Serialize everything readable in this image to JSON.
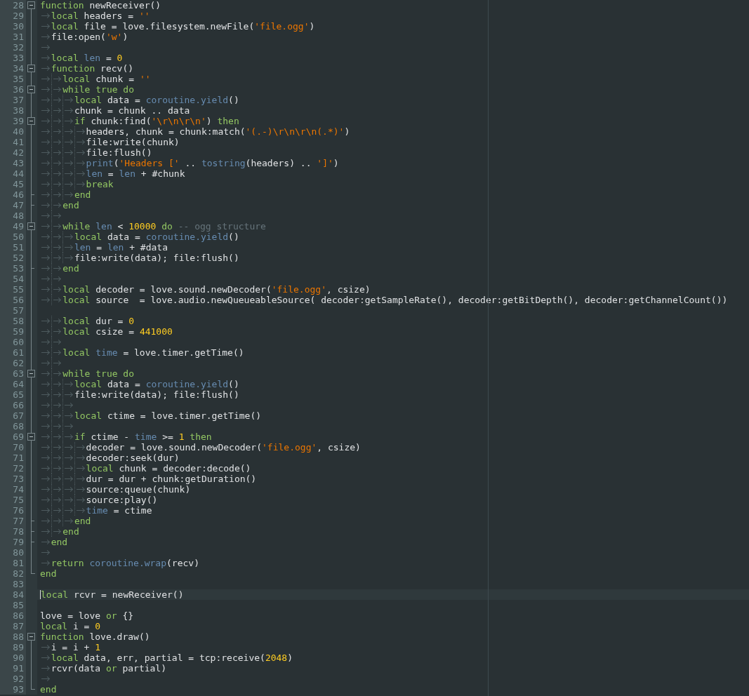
{
  "editor": {
    "lines": [
      {
        "number": "28",
        "foldable": true,
        "block_end": false,
        "current": false,
        "tokens": [
          {
            "kind": "keyword",
            "text": "function"
          },
          {
            "kind": "plain",
            "text": " newReceiver()"
          }
        ]
      },
      {
        "number": "29",
        "foldable": false,
        "block_end": false,
        "current": false,
        "tokens": [
          {
            "kind": "tab"
          },
          {
            "kind": "keyword",
            "text": "local"
          },
          {
            "kind": "plain",
            "text": " headers = "
          },
          {
            "kind": "string",
            "text": "''"
          }
        ]
      },
      {
        "number": "30",
        "foldable": false,
        "block_end": false,
        "current": false,
        "tokens": [
          {
            "kind": "tab"
          },
          {
            "kind": "keyword",
            "text": "local"
          },
          {
            "kind": "plain",
            "text": " file = love.filesystem.newFile("
          },
          {
            "kind": "string",
            "text": "'file.ogg'"
          },
          {
            "kind": "plain",
            "text": ")"
          }
        ]
      },
      {
        "number": "31",
        "foldable": false,
        "block_end": false,
        "current": false,
        "tokens": [
          {
            "kind": "tab"
          },
          {
            "kind": "plain",
            "text": "file:open("
          },
          {
            "kind": "string",
            "text": "'w'"
          },
          {
            "kind": "plain",
            "text": ")"
          }
        ]
      },
      {
        "number": "32",
        "foldable": false,
        "block_end": false,
        "current": false,
        "tokens": [
          {
            "kind": "tab"
          }
        ]
      },
      {
        "number": "33",
        "foldable": false,
        "block_end": false,
        "current": false,
        "tokens": [
          {
            "kind": "tab"
          },
          {
            "kind": "keyword",
            "text": "local"
          },
          {
            "kind": "library",
            "text": " len"
          },
          {
            "kind": "plain",
            "text": " = "
          },
          {
            "kind": "number",
            "text": "0"
          }
        ]
      },
      {
        "number": "34",
        "foldable": true,
        "block_end": false,
        "current": false,
        "tokens": [
          {
            "kind": "tab"
          },
          {
            "kind": "keyword",
            "text": "function"
          },
          {
            "kind": "plain",
            "text": " recv()"
          }
        ]
      },
      {
        "number": "35",
        "foldable": false,
        "block_end": false,
        "current": false,
        "tokens": [
          {
            "kind": "tab"
          },
          {
            "kind": "tab"
          },
          {
            "kind": "keyword",
            "text": "local"
          },
          {
            "kind": "plain",
            "text": " chunk = "
          },
          {
            "kind": "string",
            "text": "''"
          }
        ]
      },
      {
        "number": "36",
        "foldable": true,
        "block_end": false,
        "current": false,
        "tokens": [
          {
            "kind": "tab"
          },
          {
            "kind": "tab"
          },
          {
            "kind": "keyword",
            "text": "while true do"
          }
        ]
      },
      {
        "number": "37",
        "foldable": false,
        "block_end": false,
        "current": false,
        "tokens": [
          {
            "kind": "tab"
          },
          {
            "kind": "tab"
          },
          {
            "kind": "tab"
          },
          {
            "kind": "keyword",
            "text": "local"
          },
          {
            "kind": "plain",
            "text": " data = "
          },
          {
            "kind": "library",
            "text": "coroutine.yield"
          },
          {
            "kind": "plain",
            "text": "()"
          }
        ]
      },
      {
        "number": "38",
        "foldable": false,
        "block_end": false,
        "current": false,
        "tokens": [
          {
            "kind": "tab"
          },
          {
            "kind": "tab"
          },
          {
            "kind": "tab"
          },
          {
            "kind": "plain",
            "text": "chunk = chunk .. data"
          }
        ]
      },
      {
        "number": "39",
        "foldable": true,
        "block_end": false,
        "current": false,
        "tokens": [
          {
            "kind": "tab"
          },
          {
            "kind": "tab"
          },
          {
            "kind": "tab"
          },
          {
            "kind": "keyword",
            "text": "if"
          },
          {
            "kind": "plain",
            "text": " chunk:find("
          },
          {
            "kind": "string",
            "text": "'\\r\\n\\r\\n'"
          },
          {
            "kind": "plain",
            "text": ") "
          },
          {
            "kind": "keyword",
            "text": "then"
          }
        ]
      },
      {
        "number": "40",
        "foldable": false,
        "block_end": false,
        "current": false,
        "tokens": [
          {
            "kind": "tab"
          },
          {
            "kind": "tab"
          },
          {
            "kind": "tab"
          },
          {
            "kind": "tab"
          },
          {
            "kind": "plain",
            "text": "headers, chunk = chunk:match("
          },
          {
            "kind": "string",
            "text": "'(.-)\\r\\n\\r\\n(.*)'"
          },
          {
            "kind": "plain",
            "text": ")"
          }
        ]
      },
      {
        "number": "41",
        "foldable": false,
        "block_end": false,
        "current": false,
        "tokens": [
          {
            "kind": "tab"
          },
          {
            "kind": "tab"
          },
          {
            "kind": "tab"
          },
          {
            "kind": "tab"
          },
          {
            "kind": "plain",
            "text": "file:write(chunk)"
          }
        ]
      },
      {
        "number": "42",
        "foldable": false,
        "block_end": false,
        "current": false,
        "tokens": [
          {
            "kind": "tab"
          },
          {
            "kind": "tab"
          },
          {
            "kind": "tab"
          },
          {
            "kind": "tab"
          },
          {
            "kind": "plain",
            "text": "file:flush()"
          }
        ]
      },
      {
        "number": "43",
        "foldable": false,
        "block_end": false,
        "current": false,
        "tokens": [
          {
            "kind": "tab"
          },
          {
            "kind": "tab"
          },
          {
            "kind": "tab"
          },
          {
            "kind": "tab"
          },
          {
            "kind": "library",
            "text": "print"
          },
          {
            "kind": "plain",
            "text": "("
          },
          {
            "kind": "string",
            "text": "'Headers ['"
          },
          {
            "kind": "plain",
            "text": " .. "
          },
          {
            "kind": "library",
            "text": "tostring"
          },
          {
            "kind": "plain",
            "text": "(headers) .. "
          },
          {
            "kind": "string",
            "text": "']'"
          },
          {
            "kind": "plain",
            "text": ")"
          }
        ]
      },
      {
        "number": "44",
        "foldable": false,
        "block_end": false,
        "current": false,
        "tokens": [
          {
            "kind": "tab"
          },
          {
            "kind": "tab"
          },
          {
            "kind": "tab"
          },
          {
            "kind": "tab"
          },
          {
            "kind": "library",
            "text": "len"
          },
          {
            "kind": "plain",
            "text": " = "
          },
          {
            "kind": "library",
            "text": "len"
          },
          {
            "kind": "plain",
            "text": " + #chunk"
          }
        ]
      },
      {
        "number": "45",
        "foldable": false,
        "block_end": false,
        "current": false,
        "tokens": [
          {
            "kind": "tab"
          },
          {
            "kind": "tab"
          },
          {
            "kind": "tab"
          },
          {
            "kind": "tab"
          },
          {
            "kind": "keyword",
            "text": "break"
          }
        ]
      },
      {
        "number": "46",
        "foldable": false,
        "block_end": true,
        "current": false,
        "tokens": [
          {
            "kind": "tab"
          },
          {
            "kind": "tab"
          },
          {
            "kind": "tab"
          },
          {
            "kind": "keyword",
            "text": "end"
          }
        ]
      },
      {
        "number": "47",
        "foldable": false,
        "block_end": true,
        "current": false,
        "tokens": [
          {
            "kind": "tab"
          },
          {
            "kind": "tab"
          },
          {
            "kind": "keyword",
            "text": "end"
          }
        ]
      },
      {
        "number": "48",
        "foldable": false,
        "block_end": false,
        "current": false,
        "tokens": [
          {
            "kind": "tab"
          },
          {
            "kind": "tab"
          }
        ]
      },
      {
        "number": "49",
        "foldable": true,
        "block_end": false,
        "current": false,
        "tokens": [
          {
            "kind": "tab"
          },
          {
            "kind": "tab"
          },
          {
            "kind": "keyword",
            "text": "while"
          },
          {
            "kind": "library",
            "text": " len"
          },
          {
            "kind": "plain",
            "text": " < "
          },
          {
            "kind": "number",
            "text": "10000"
          },
          {
            "kind": "keyword",
            "text": " do"
          },
          {
            "kind": "comment",
            "text": " -- ogg structure"
          }
        ]
      },
      {
        "number": "50",
        "foldable": false,
        "block_end": false,
        "current": false,
        "tokens": [
          {
            "kind": "tab"
          },
          {
            "kind": "tab"
          },
          {
            "kind": "tab"
          },
          {
            "kind": "keyword",
            "text": "local"
          },
          {
            "kind": "plain",
            "text": " data = "
          },
          {
            "kind": "library",
            "text": "coroutine.yield"
          },
          {
            "kind": "plain",
            "text": "()"
          }
        ]
      },
      {
        "number": "51",
        "foldable": false,
        "block_end": false,
        "current": false,
        "tokens": [
          {
            "kind": "tab"
          },
          {
            "kind": "tab"
          },
          {
            "kind": "tab"
          },
          {
            "kind": "library",
            "text": "len"
          },
          {
            "kind": "plain",
            "text": " = "
          },
          {
            "kind": "library",
            "text": "len"
          },
          {
            "kind": "plain",
            "text": " + #data"
          }
        ]
      },
      {
        "number": "52",
        "foldable": false,
        "block_end": false,
        "current": false,
        "tokens": [
          {
            "kind": "tab"
          },
          {
            "kind": "tab"
          },
          {
            "kind": "tab"
          },
          {
            "kind": "plain",
            "text": "file:write(data); file:flush()"
          }
        ]
      },
      {
        "number": "53",
        "foldable": false,
        "block_end": true,
        "current": false,
        "tokens": [
          {
            "kind": "tab"
          },
          {
            "kind": "tab"
          },
          {
            "kind": "keyword",
            "text": "end"
          }
        ]
      },
      {
        "number": "54",
        "foldable": false,
        "block_end": false,
        "current": false,
        "tokens": [
          {
            "kind": "tab"
          },
          {
            "kind": "tab"
          }
        ]
      },
      {
        "number": "55",
        "foldable": false,
        "block_end": false,
        "current": false,
        "tokens": [
          {
            "kind": "tab"
          },
          {
            "kind": "tab"
          },
          {
            "kind": "keyword",
            "text": "local"
          },
          {
            "kind": "plain",
            "text": " decoder = love.sound.newDecoder("
          },
          {
            "kind": "string",
            "text": "'file.ogg'"
          },
          {
            "kind": "plain",
            "text": ", csize)"
          }
        ]
      },
      {
        "number": "56",
        "foldable": false,
        "block_end": false,
        "current": false,
        "tokens": [
          {
            "kind": "tab"
          },
          {
            "kind": "tab"
          },
          {
            "kind": "keyword",
            "text": "local"
          },
          {
            "kind": "plain",
            "text": " source  = love.audio.newQueueableSource( decoder:getSampleRate(), decoder:getBitDepth(), decoder:getChannelCount())"
          }
        ]
      },
      {
        "number": "57",
        "foldable": false,
        "block_end": false,
        "current": false
      },
      {
        "number": "58",
        "foldable": false,
        "block_end": false,
        "current": false,
        "tokens": [
          {
            "kind": "tab"
          },
          {
            "kind": "tab"
          },
          {
            "kind": "keyword",
            "text": "local"
          },
          {
            "kind": "plain",
            "text": " dur = "
          },
          {
            "kind": "number",
            "text": "0"
          }
        ]
      },
      {
        "number": "59",
        "foldable": false,
        "block_end": false,
        "current": false,
        "tokens": [
          {
            "kind": "tab"
          },
          {
            "kind": "tab"
          },
          {
            "kind": "keyword",
            "text": "local"
          },
          {
            "kind": "plain",
            "text": " csize = "
          },
          {
            "kind": "number",
            "text": "441000"
          }
        ]
      },
      {
        "number": "60",
        "foldable": false,
        "block_end": false,
        "current": false,
        "tokens": [
          {
            "kind": "tab"
          },
          {
            "kind": "tab"
          }
        ]
      },
      {
        "number": "61",
        "foldable": false,
        "block_end": false,
        "current": false,
        "tokens": [
          {
            "kind": "tab"
          },
          {
            "kind": "tab"
          },
          {
            "kind": "keyword",
            "text": "local"
          },
          {
            "kind": "library",
            "text": " time"
          },
          {
            "kind": "plain",
            "text": " = love.timer.getTime()"
          }
        ]
      },
      {
        "number": "62",
        "foldable": false,
        "block_end": false,
        "current": false,
        "tokens": [
          {
            "kind": "tab"
          },
          {
            "kind": "tab"
          }
        ]
      },
      {
        "number": "63",
        "foldable": true,
        "block_end": false,
        "current": false,
        "tokens": [
          {
            "kind": "tab"
          },
          {
            "kind": "tab"
          },
          {
            "kind": "keyword",
            "text": "while true do"
          }
        ]
      },
      {
        "number": "64",
        "foldable": false,
        "block_end": false,
        "current": false,
        "tokens": [
          {
            "kind": "tab"
          },
          {
            "kind": "tab"
          },
          {
            "kind": "tab"
          },
          {
            "kind": "keyword",
            "text": "local"
          },
          {
            "kind": "plain",
            "text": " data = "
          },
          {
            "kind": "library",
            "text": "coroutine.yield"
          },
          {
            "kind": "plain",
            "text": "()"
          }
        ]
      },
      {
        "number": "65",
        "foldable": false,
        "block_end": false,
        "current": false,
        "tokens": [
          {
            "kind": "tab"
          },
          {
            "kind": "tab"
          },
          {
            "kind": "tab"
          },
          {
            "kind": "plain",
            "text": "file:write(data); file:flush()"
          }
        ]
      },
      {
        "number": "66",
        "foldable": false,
        "block_end": false,
        "current": false,
        "tokens": [
          {
            "kind": "tab"
          },
          {
            "kind": "tab"
          },
          {
            "kind": "tab"
          }
        ]
      },
      {
        "number": "67",
        "foldable": false,
        "block_end": false,
        "current": false,
        "tokens": [
          {
            "kind": "tab"
          },
          {
            "kind": "tab"
          },
          {
            "kind": "tab"
          },
          {
            "kind": "keyword",
            "text": "local"
          },
          {
            "kind": "plain",
            "text": " ctime = love.timer.getTime()"
          }
        ]
      },
      {
        "number": "68",
        "foldable": false,
        "block_end": false,
        "current": false,
        "tokens": [
          {
            "kind": "tab"
          },
          {
            "kind": "tab"
          },
          {
            "kind": "tab"
          }
        ]
      },
      {
        "number": "69",
        "foldable": true,
        "block_end": false,
        "current": false,
        "tokens": [
          {
            "kind": "tab"
          },
          {
            "kind": "tab"
          },
          {
            "kind": "tab"
          },
          {
            "kind": "keyword",
            "text": "if"
          },
          {
            "kind": "plain",
            "text": " ctime - "
          },
          {
            "kind": "library",
            "text": "time"
          },
          {
            "kind": "plain",
            "text": " >= "
          },
          {
            "kind": "number",
            "text": "1"
          },
          {
            "kind": "keyword",
            "text": " then"
          }
        ]
      },
      {
        "number": "70",
        "foldable": false,
        "block_end": false,
        "current": false,
        "tokens": [
          {
            "kind": "tab"
          },
          {
            "kind": "tab"
          },
          {
            "kind": "tab"
          },
          {
            "kind": "tab"
          },
          {
            "kind": "plain",
            "text": "decoder = love.sound.newDecoder("
          },
          {
            "kind": "string",
            "text": "'file.ogg'"
          },
          {
            "kind": "plain",
            "text": ", csize)"
          }
        ]
      },
      {
        "number": "71",
        "foldable": false,
        "block_end": false,
        "current": false,
        "tokens": [
          {
            "kind": "tab"
          },
          {
            "kind": "tab"
          },
          {
            "kind": "tab"
          },
          {
            "kind": "tab"
          },
          {
            "kind": "plain",
            "text": "decoder:seek(dur)"
          }
        ]
      },
      {
        "number": "72",
        "foldable": false,
        "block_end": false,
        "current": false,
        "tokens": [
          {
            "kind": "tab"
          },
          {
            "kind": "tab"
          },
          {
            "kind": "tab"
          },
          {
            "kind": "tab"
          },
          {
            "kind": "keyword",
            "text": "local"
          },
          {
            "kind": "plain",
            "text": " chunk = decoder:decode()"
          }
        ]
      },
      {
        "number": "73",
        "foldable": false,
        "block_end": false,
        "current": false,
        "tokens": [
          {
            "kind": "tab"
          },
          {
            "kind": "tab"
          },
          {
            "kind": "tab"
          },
          {
            "kind": "tab"
          },
          {
            "kind": "plain",
            "text": "dur = dur + chunk:getDuration()"
          }
        ]
      },
      {
        "number": "74",
        "foldable": false,
        "block_end": false,
        "current": false,
        "tokens": [
          {
            "kind": "tab"
          },
          {
            "kind": "tab"
          },
          {
            "kind": "tab"
          },
          {
            "kind": "tab"
          },
          {
            "kind": "plain",
            "text": "source:queue(chunk)"
          }
        ]
      },
      {
        "number": "75",
        "foldable": false,
        "block_end": false,
        "current": false,
        "tokens": [
          {
            "kind": "tab"
          },
          {
            "kind": "tab"
          },
          {
            "kind": "tab"
          },
          {
            "kind": "tab"
          },
          {
            "kind": "plain",
            "text": "source:play()"
          }
        ]
      },
      {
        "number": "76",
        "foldable": false,
        "block_end": false,
        "current": false,
        "tokens": [
          {
            "kind": "tab"
          },
          {
            "kind": "tab"
          },
          {
            "kind": "tab"
          },
          {
            "kind": "tab"
          },
          {
            "kind": "library",
            "text": "time"
          },
          {
            "kind": "plain",
            "text": " = ctime"
          }
        ]
      },
      {
        "number": "77",
        "foldable": false,
        "block_end": true,
        "current": false,
        "tokens": [
          {
            "kind": "tab"
          },
          {
            "kind": "tab"
          },
          {
            "kind": "tab"
          },
          {
            "kind": "keyword",
            "text": "end"
          }
        ]
      },
      {
        "number": "78",
        "foldable": false,
        "block_end": true,
        "current": false,
        "tokens": [
          {
            "kind": "tab"
          },
          {
            "kind": "tab"
          },
          {
            "kind": "keyword",
            "text": "end"
          }
        ]
      },
      {
        "number": "79",
        "foldable": false,
        "block_end": true,
        "current": false,
        "tokens": [
          {
            "kind": "tab"
          },
          {
            "kind": "keyword",
            "text": "end"
          }
        ]
      },
      {
        "number": "80",
        "foldable": false,
        "block_end": false,
        "current": false,
        "tokens": [
          {
            "kind": "tab"
          }
        ]
      },
      {
        "number": "81",
        "foldable": false,
        "block_end": false,
        "current": false,
        "tokens": [
          {
            "kind": "tab"
          },
          {
            "kind": "keyword",
            "text": "return"
          },
          {
            "kind": "library",
            "text": " coroutine.wrap"
          },
          {
            "kind": "plain",
            "text": "(recv)"
          }
        ]
      },
      {
        "number": "82",
        "foldable": false,
        "block_end": true,
        "current": false,
        "tokens": [
          {
            "kind": "keyword",
            "text": "end"
          }
        ]
      },
      {
        "number": "83",
        "foldable": false,
        "block_end": false,
        "current": false
      },
      {
        "number": "84",
        "foldable": false,
        "block_end": false,
        "current": true,
        "tokens": [
          {
            "kind": "keyword",
            "text": "local"
          },
          {
            "kind": "plain",
            "text": " rcvr = newReceiver()"
          }
        ]
      },
      {
        "number": "85",
        "foldable": false,
        "block_end": false,
        "current": false
      },
      {
        "number": "86",
        "foldable": false,
        "block_end": false,
        "current": false,
        "tokens": [
          {
            "kind": "plain",
            "text": "love = love "
          },
          {
            "kind": "keyword",
            "text": "or"
          },
          {
            "kind": "plain",
            "text": " {}"
          }
        ]
      },
      {
        "number": "87",
        "foldable": false,
        "block_end": false,
        "current": false,
        "tokens": [
          {
            "kind": "keyword",
            "text": "local"
          },
          {
            "kind": "plain",
            "text": " i = "
          },
          {
            "kind": "number",
            "text": "0"
          }
        ]
      },
      {
        "number": "88",
        "foldable": true,
        "block_end": false,
        "current": false,
        "tokens": [
          {
            "kind": "keyword",
            "text": "function"
          },
          {
            "kind": "plain",
            "text": " love.draw()"
          }
        ]
      },
      {
        "number": "89",
        "foldable": false,
        "block_end": false,
        "current": false,
        "tokens": [
          {
            "kind": "tab"
          },
          {
            "kind": "plain",
            "text": "i = i + "
          },
          {
            "kind": "number",
            "text": "1"
          }
        ]
      },
      {
        "number": "90",
        "foldable": false,
        "block_end": false,
        "current": false,
        "tokens": [
          {
            "kind": "tab"
          },
          {
            "kind": "keyword",
            "text": "local"
          },
          {
            "kind": "plain",
            "text": " data, err, partial = tcp:receive("
          },
          {
            "kind": "number",
            "text": "2048"
          },
          {
            "kind": "plain",
            "text": ")"
          }
        ]
      },
      {
        "number": "91",
        "foldable": false,
        "block_end": false,
        "current": false,
        "tokens": [
          {
            "kind": "tab"
          },
          {
            "kind": "plain",
            "text": "rcvr(data "
          },
          {
            "kind": "keyword",
            "text": "or"
          },
          {
            "kind": "plain",
            "text": " partial)"
          }
        ]
      },
      {
        "number": "92",
        "foldable": false,
        "block_end": false,
        "current": false,
        "tokens": [
          {
            "kind": "tab"
          }
        ]
      },
      {
        "number": "93",
        "foldable": false,
        "block_end": true,
        "current": false,
        "tokens": [
          {
            "kind": "keyword",
            "text": "end"
          }
        ]
      }
    ]
  }
}
